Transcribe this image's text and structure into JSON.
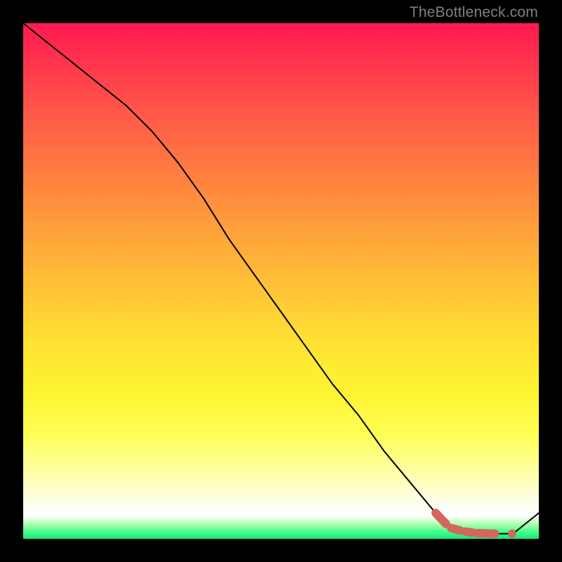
{
  "watermark": "TheBottleneck.com",
  "colors": {
    "page_bg": "#000000",
    "line": "#000000",
    "datapoint": "#d5655f",
    "gradient_top": "#ff1850",
    "gradient_bottom": "#12e87a"
  },
  "chart_data": {
    "type": "line",
    "title": "",
    "xlabel": "",
    "ylabel": "",
    "xlim": [
      0,
      100
    ],
    "ylim": [
      0,
      100
    ],
    "grid": false,
    "legend": false,
    "series": [
      {
        "name": "main-curve",
        "x": [
          0,
          5,
          10,
          15,
          20,
          25,
          30,
          35,
          40,
          45,
          50,
          55,
          60,
          65,
          70,
          75,
          80,
          83,
          86,
          89,
          92,
          95,
          100
        ],
        "y": [
          100,
          96,
          92,
          88,
          84,
          79,
          73,
          66,
          58,
          51,
          44,
          37,
          30,
          24,
          17,
          11,
          5,
          2.5,
          1.5,
          1.0,
          1.0,
          1.0,
          5
        ]
      }
    ],
    "datapoints": {
      "name": "highlighted-range",
      "description": "thick salmon segments near the trough plus one isolated dot",
      "segments": [
        {
          "x": [
            80.0,
            82.0
          ],
          "y": [
            5.0,
            2.9
          ]
        },
        {
          "x": [
            83.0,
            84.8
          ],
          "y": [
            2.1,
            1.6
          ]
        },
        {
          "x": [
            85.8,
            87.2
          ],
          "y": [
            1.4,
            1.2
          ]
        },
        {
          "x": [
            88.2,
            91.5
          ],
          "y": [
            1.1,
            1.0
          ]
        }
      ],
      "dot": {
        "x": 94.8,
        "y": 1.0
      }
    }
  }
}
